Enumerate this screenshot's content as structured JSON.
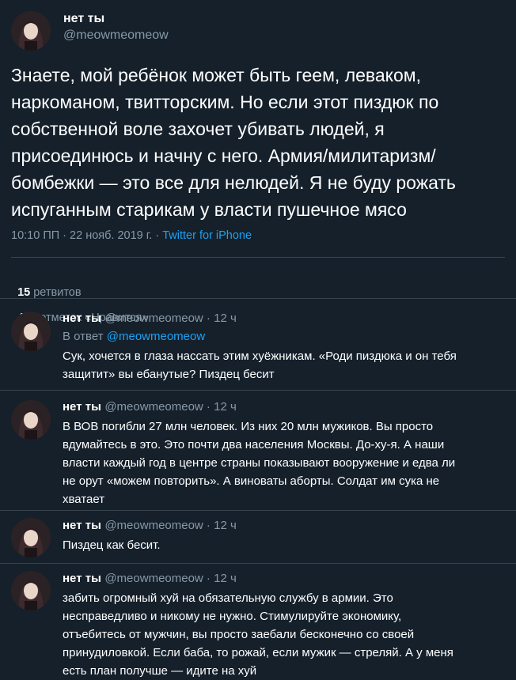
{
  "tweet": {
    "author_name": "нет ты",
    "author_handle": "@meowmeomeow",
    "text_lines": [
      "Знаете, мой ребёнок может быть геем, леваком,",
      "наркоманом, твитторским. Но если этот пиздюк по",
      "собственной воле захочет убивать людей, я",
      "присоединюсь и начну с него. Армия/милитаризм/",
      "бомбежки — это все для нелюдей. Я не буду рожать",
      "испуганным старикам у власти пушечное мясо"
    ],
    "timestamp": "10:10 ПП · 22 нояб. 2019 г. · ",
    "source": "Twitter for iPhone",
    "retweets_count": "15",
    "retweets_label": " ретвитов",
    "likes_count": "448",
    "likes_label": " отметок «Нравится»"
  },
  "replies": [
    {
      "name": "нет ты",
      "handle": "@meowmeomeow",
      "time": " · 12 ч",
      "reply_to_prefix": "В ответ ",
      "reply_to_handle": "@meowmeomeow",
      "lines": [
        "Сук, хочется в глаза нассать этим хуёжникам. «Роди пиздюка и он тебя",
        "защитит» вы ебанутые? Пиздец бесит"
      ]
    },
    {
      "name": "нет ты",
      "handle": "@meowmeomeow",
      "time": " · 12 ч",
      "lines": [
        "В ВОВ погибли 27 млн человек. Из них 20 млн мужиков. Вы просто",
        "вдумайтесь в это. Это почти два населения Москвы. До-ху-я. А наши",
        "власти каждый год в центре страны показывают вооружение и едва ли",
        "не орут «можем повторить». А виноваты аборты. Солдат им сука не",
        "хватает"
      ]
    },
    {
      "name": "нет ты",
      "handle": "@meowmeomeow",
      "time": " · 12 ч",
      "lines": [
        "Пиздец как бесит."
      ]
    },
    {
      "name": "нет ты",
      "handle": "@meowmeomeow",
      "time": " · 12 ч",
      "lines": [
        "забить огромный хуй на обязательную службу в армии. Это",
        "несправедливо и никому не нужно. Стимулируйте экономику,",
        "отъебитесь от мужчин, вы просто заебали бесконечно со своей",
        "принудиловкой. Если баба, то рожай, если мужик — стреляй. А у меня",
        "есть план получше — идите на хуй"
      ]
    }
  ]
}
